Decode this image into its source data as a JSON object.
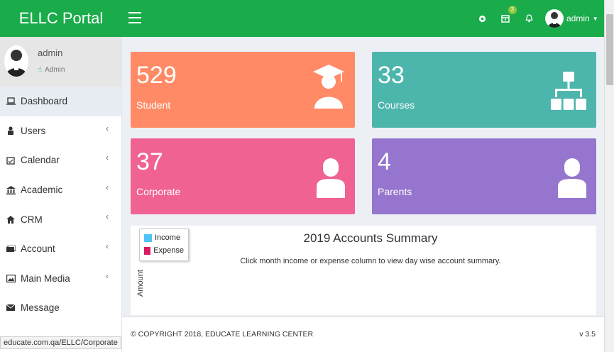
{
  "header": {
    "brand": "ELLC Portal",
    "notification_count": "3",
    "user_name": "admin"
  },
  "sidebar": {
    "user_name": "admin",
    "user_role": "Admin",
    "items": [
      {
        "label": "Dashboard",
        "icon": "laptop-icon"
      },
      {
        "label": "Users",
        "icon": "user-icon"
      },
      {
        "label": "Calendar",
        "icon": "calendar-icon"
      },
      {
        "label": "Academic",
        "icon": "building-icon"
      },
      {
        "label": "CRM",
        "icon": "home-icon"
      },
      {
        "label": "Account",
        "icon": "money-icon"
      },
      {
        "label": "Main Media",
        "icon": "image-icon"
      },
      {
        "label": "Message",
        "icon": "envelope-icon"
      }
    ]
  },
  "cards": [
    {
      "value": "529",
      "label": "Student",
      "color": "#ff8a65",
      "icon": "graduate-icon"
    },
    {
      "value": "33",
      "label": "Courses",
      "color": "#4db6ac",
      "icon": "sitemap-icon"
    },
    {
      "value": "37",
      "label": "Corporate",
      "color": "#f06292",
      "icon": "person-icon"
    },
    {
      "value": "4",
      "label": "Parents",
      "color": "#9575cd",
      "icon": "person-icon"
    }
  ],
  "chart": {
    "title": "2019 Accounts Summary",
    "subtitle": "Click month income or expense column to view day wise account summary.",
    "ylabel": "Amount",
    "legend": [
      {
        "name": "Income",
        "color": "#4fc3f7"
      },
      {
        "name": "Expense",
        "color": "#d81b60"
      }
    ]
  },
  "footer": {
    "copyright": "© COPYRIGHT 2018, EDUCATE LEARNING CENTER",
    "version": "v 3.5"
  },
  "statusbar": {
    "url": "educate.com.qa/ELLC/Corporate"
  }
}
